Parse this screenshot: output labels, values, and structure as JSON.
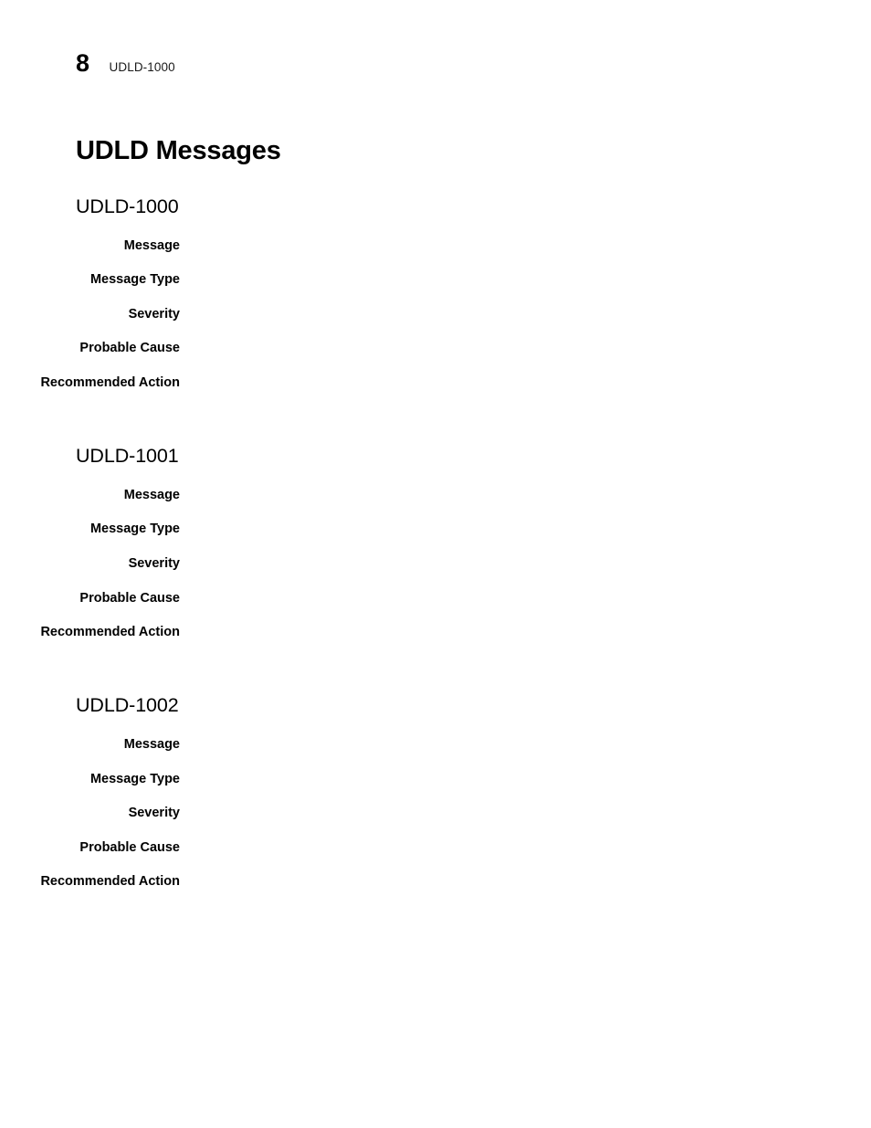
{
  "header": {
    "page_number": "8",
    "running_title": "UDLD-1000"
  },
  "chapter": {
    "title": "UDLD Messages"
  },
  "field_labels": {
    "message": "Message",
    "message_type": "Message Type",
    "severity": "Severity",
    "probable_cause": "Probable Cause",
    "recommended_action": "Recommended Action"
  },
  "sections": [
    {
      "id": "UDLD-1000",
      "heading": "UDLD-1000",
      "fields": [
        {
          "label": "Message",
          "value": ""
        },
        {
          "label": "Message Type",
          "value": ""
        },
        {
          "label": "Severity",
          "value": ""
        },
        {
          "label": "Probable Cause",
          "value": ""
        },
        {
          "label": "Recommended Action",
          "value": ""
        }
      ]
    },
    {
      "id": "UDLD-1001",
      "heading": "UDLD-1001",
      "fields": [
        {
          "label": "Message",
          "value": ""
        },
        {
          "label": "Message Type",
          "value": ""
        },
        {
          "label": "Severity",
          "value": ""
        },
        {
          "label": "Probable Cause",
          "value": ""
        },
        {
          "label": "Recommended Action",
          "value": ""
        }
      ]
    },
    {
      "id": "UDLD-1002",
      "heading": "UDLD-1002",
      "fields": [
        {
          "label": "Message",
          "value": ""
        },
        {
          "label": "Message Type",
          "value": ""
        },
        {
          "label": "Severity",
          "value": ""
        },
        {
          "label": "Probable Cause",
          "value": ""
        },
        {
          "label": "Recommended Action",
          "value": ""
        }
      ]
    }
  ],
  "colors": {
    "page_background": "#ffffff",
    "text": "#000000",
    "header_text": "#1a1a1a"
  }
}
